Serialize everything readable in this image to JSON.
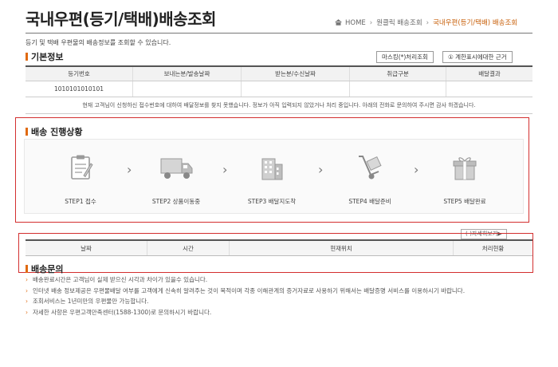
{
  "header": {
    "title": "국내우편(등기/택배)배송조회",
    "breadcrumb": [
      "HOME",
      "원클릭 배송조회",
      "국내우편(등기/택배) 배송조회"
    ]
  },
  "intro_text": "등기 및 택배 우편물의 배송정보를 조회할 수 있습니다.",
  "basic": {
    "title": "기본정보",
    "buttons": [
      "마스킹(*)처리조회",
      "① 계한표시에대한 근거"
    ],
    "columns": [
      "등기번호",
      "보내는분/발송날짜",
      "받는분/수신날짜",
      "취급구분",
      "배달결과"
    ],
    "row": [
      "1010101010101",
      "",
      "",
      "",
      ""
    ],
    "message": "현재 고객님이 신청하신 접수번호에 대하여 배달정보를 찾지 못했습니다. 정보가 아직 입력되지 않았거나 처리 중입니다. 아래의 전화로 문의하여 주시면 감사 하겠습니다."
  },
  "progress": {
    "title": "배송 진행상황",
    "steps": [
      {
        "label": "STEP1 접수",
        "icon": "clipboard-icon"
      },
      {
        "label": "STEP2 상품이동중",
        "icon": "truck-icon"
      },
      {
        "label": "STEP3 배달지도착",
        "icon": "building-icon"
      },
      {
        "label": "STEP4 배달준비",
        "icon": "hand-truck-icon"
      },
      {
        "label": "STEP5 배달완료",
        "icon": "gift-icon"
      }
    ],
    "detail_button": "(-)자세히보기▶"
  },
  "history": {
    "columns": [
      "날짜",
      "시간",
      "현재위치",
      "처리현황"
    ]
  },
  "inquiry": {
    "title": "배송문의",
    "notes": [
      "배송완료시간은 고객님이 실제 받으신 시각과 차이가 있을수 있습니다.",
      "인터넷 배송 정보제공은 우편물배달 여부를 고객에게 신속히 알려주는 것이 목적이며 각종 이해관계의 증거자료로 사용하기 위해서는 배달증명 서비스를 이용하시기 바랍니다.",
      "조회서비스는 1년미만의 우편물만 가능합니다.",
      "자세한 사항은 우편고객만족센터(1588-1300)로 문의하시기 바랍니다."
    ]
  },
  "colors": {
    "accent": "#e06a10",
    "highlight_box": "#d32f2f",
    "breadcrumb_current": "#c8600b"
  }
}
